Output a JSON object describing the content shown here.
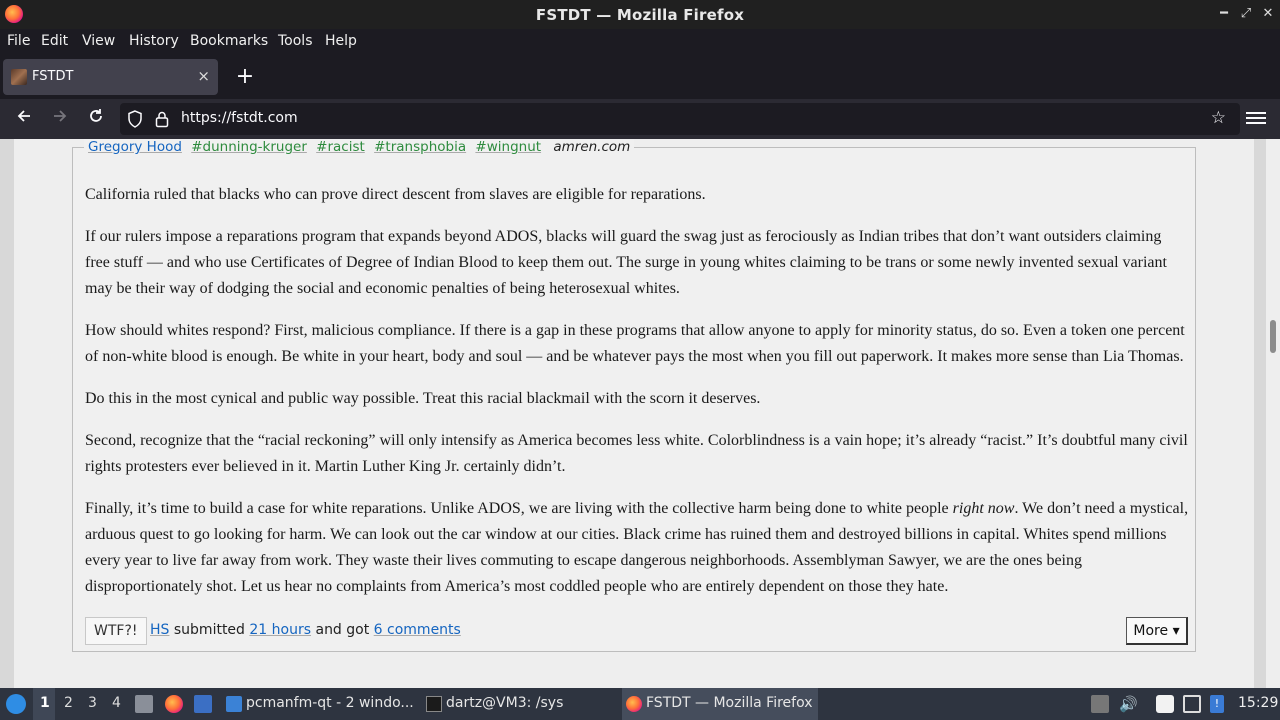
{
  "window": {
    "title": "FSTDT — Mozilla Firefox"
  },
  "menu": [
    "File",
    "Edit",
    "View",
    "History",
    "Bookmarks",
    "Tools",
    "Help"
  ],
  "tab": {
    "title": "FSTDT",
    "close": "×"
  },
  "newtab": "+",
  "url": "https://fstdt.com",
  "post": {
    "author": "Gregory Hood",
    "tags": [
      "#dunning-kruger",
      "#racist",
      "#transphobia",
      "#wingnut"
    ],
    "source": "amren.com",
    "paragraphs": [
      "California ruled that blacks who can prove direct descent from slaves are eligible for reparations.",
      "If our rulers impose a reparations program that expands beyond ADOS, blacks will guard the swag just as ferociously as Indian tribes that don’t want outsiders claiming free stuff — and who use Certificates of Degree of Indian Blood to keep them out. The surge in young whites claiming to be trans or some newly invented sexual variant may be their way of dodging the social and economic penalties of being heterosexual whites.",
      "How should whites respond? First, malicious compliance. If there is a gap in these programs that allow anyone to apply for minority status, do so. Even a token one percent of non-white blood is enough. Be white in your heart, body and soul — and be whatever pays the most when you fill out paperwork. It makes more sense than Lia Thomas.",
      "Do this in the most cynical and public way possible. Treat this racial blackmail with the scorn it deserves.",
      "Second, recognize that the “racial reckoning” will only intensify as America becomes less white. Colorblindness is a vain hope; it’s already “racist.” It’s doubtful many civil rights protesters ever believed in it. Martin Luther King Jr. certainly didn’t."
    ],
    "last_paragraph": {
      "before": "Finally, it’s time to build a case for white reparations. Unlike ADOS, we are living with the collective harm being done to white people ",
      "emphasis": "right now",
      "after": ". We don’t need a mystical, arduous quest to go looking for harm. We can look out the car window at our cities. Black crime has ruined them and destroyed billions in capital. Whites spend millions every year to live far away from work. They waste their lives commuting to escape dangerous neighborhoods. Assemblyman Sawyer, we are the ones being disproportionately shot. Let us hear no complaints from America’s most coddled people who are entirely dependent on those they hate."
    },
    "footer": {
      "wtf_label": "WTF?!",
      "submitter": "HS",
      "submitted_text": "submitted",
      "time": "21 hours",
      "and_got": "and got",
      "comments": "6 comments",
      "more_label": "More ▾"
    }
  },
  "taskbar": {
    "workspaces": [
      "1",
      "2",
      "3",
      "4"
    ],
    "tasks": [
      {
        "label": "pcmanfm-qt - 2 windo..."
      },
      {
        "label": "dartz@VM3: /sys"
      },
      {
        "label": "FSTDT — Mozilla Firefox"
      }
    ],
    "clock": "15:29"
  }
}
